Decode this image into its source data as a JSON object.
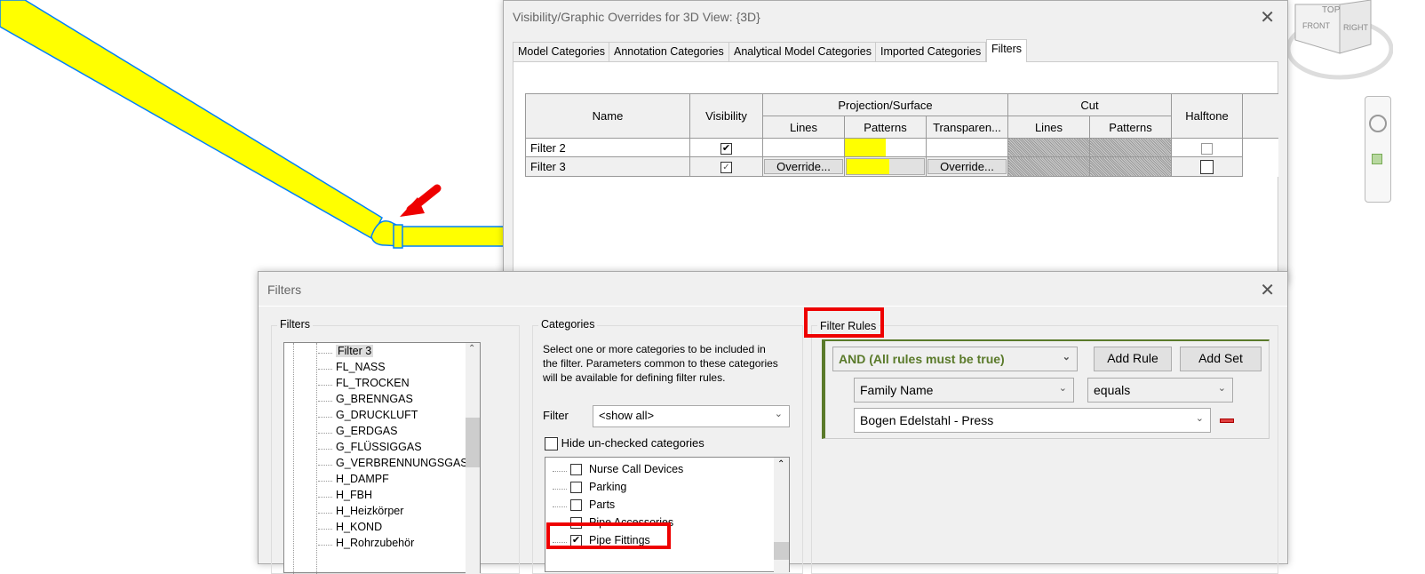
{
  "vg_dialog": {
    "title": "Visibility/Graphic Overrides for 3D View: {3D}",
    "tabs": [
      "Model Categories",
      "Annotation Categories",
      "Analytical Model Categories",
      "Imported Categories",
      "Filters"
    ],
    "active_tab": "Filters",
    "headers": {
      "name": "Name",
      "visibility": "Visibility",
      "projection": "Projection/Surface",
      "lines": "Lines",
      "patterns": "Patterns",
      "transparency": "Transparen...",
      "cut": "Cut",
      "cut_lines": "Lines",
      "cut_patterns": "Patterns",
      "halftone": "Halftone"
    },
    "rows": [
      {
        "name": "Filter 2",
        "visible": true,
        "pattern_color": "#ffff00",
        "halftone": false
      },
      {
        "name": "Filter 3",
        "visible": true,
        "lines": "Override...",
        "pattern_color": "#ffff00",
        "transparency": "Override...",
        "halftone": false
      }
    ]
  },
  "filters_dialog": {
    "title": "Filters",
    "filters_group": "Filters",
    "filter_list": [
      "Filter 3",
      "FL_NASS",
      "FL_TROCKEN",
      "G_BRENNGAS",
      "G_DRUCKLUFT",
      "G_ERDGAS",
      "G_FLÜSSIGGAS",
      "G_VERBRENNUNGSGAS",
      "H_DAMPF",
      "H_FBH",
      "H_Heizkörper",
      "H_KOND",
      "H_Rohrzubehör"
    ],
    "selected_filter": "Filter 3",
    "categories_group": "Categories",
    "categories_help": "Select one or more categories to be included in the filter.  Parameters common to these categories will be available for defining filter rules.",
    "filter_label": "Filter",
    "filter_value": "<show all>",
    "hide_unchecked_label": "Hide un-checked categories",
    "categories": [
      {
        "label": "Nurse Call Devices",
        "checked": false
      },
      {
        "label": "Parking",
        "checked": false
      },
      {
        "label": "Parts",
        "checked": false
      },
      {
        "label": "Pipe Accessories",
        "checked": false
      },
      {
        "label": "Pipe Fittings",
        "checked": true
      }
    ],
    "rules_group": "Filter Rules",
    "logic": "AND (All rules must be true)",
    "add_rule": "Add Rule",
    "add_set": "Add Set",
    "rule": {
      "parameter": "Family Name",
      "operator": "equals",
      "value": "Bogen Edelstahl - Press"
    }
  },
  "viewcube": {
    "top": "TOP",
    "front": "FRONT",
    "right": "RIGHT"
  },
  "colors": {
    "pipe": "#ffff00",
    "pipe_edge": "#0080ff",
    "highlight": "#e00000",
    "rule_green": "#5a7a2a"
  }
}
